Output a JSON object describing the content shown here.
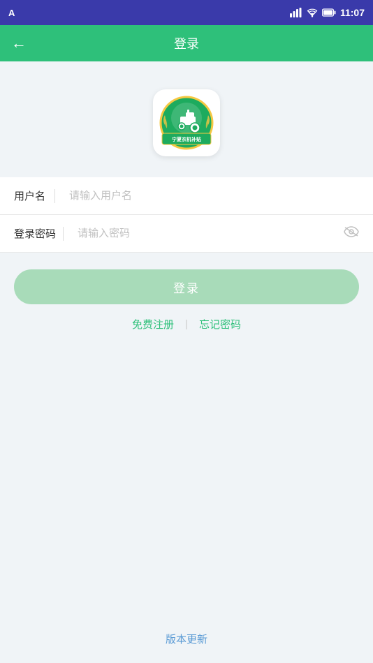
{
  "statusBar": {
    "appLabel": "A",
    "time": "11:07",
    "signalIcon": "signal",
    "wifiIcon": "wifi",
    "batteryIcon": "battery"
  },
  "appBar": {
    "backIcon": "←",
    "title": "登录"
  },
  "logo": {
    "altText": "宁夏农机补贴 App Logo"
  },
  "form": {
    "usernameLabel": "用户名",
    "usernamePlaceholder": "请输入用户名",
    "passwordLabel": "登录密码",
    "passwordPlaceholder": "请输入密码"
  },
  "buttons": {
    "loginLabel": "登录",
    "registerLabel": "免费注册",
    "forgotLabel": "忘记密码",
    "versionLabel": "版本更新"
  }
}
